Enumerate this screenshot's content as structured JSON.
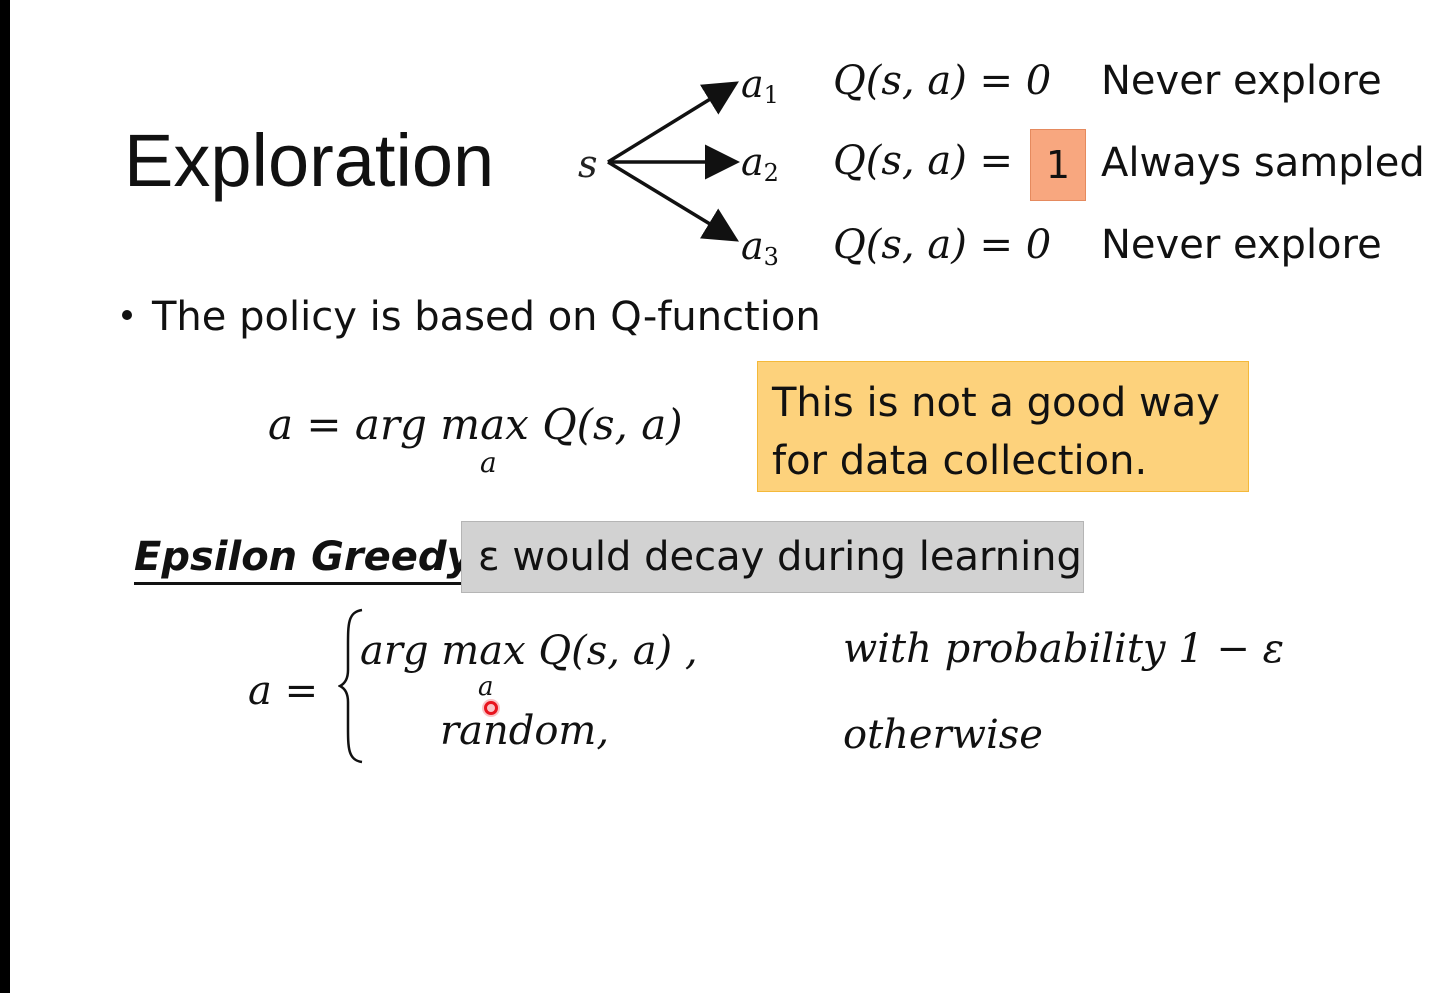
{
  "title": "Exploration",
  "tree": {
    "state": "s",
    "actions": [
      {
        "base": "a",
        "sub": "1",
        "q_expr": "Q(s, a) = 0",
        "label": "Never explore"
      },
      {
        "base": "a",
        "sub": "2",
        "q_expr": "Q(s, a) =",
        "q_value": "1",
        "label": "Always sampled"
      },
      {
        "base": "a",
        "sub": "3",
        "q_expr": "Q(s, a) = 0",
        "label": "Never explore"
      }
    ]
  },
  "bullet": "The policy is based on Q-function",
  "policy_formula": {
    "main": "a = arg max Q(s, a)",
    "subscript": "a"
  },
  "note": "This is not a good way for data collection.",
  "epsilon_greedy": {
    "title": "Epsilon Greedy",
    "decay_note": "ε would decay during learning",
    "lhs": "a =",
    "case1": {
      "expr": "arg max Q(s, a) ,",
      "subscript": "a",
      "condition": "with probability 1 − ε"
    },
    "case2": {
      "expr": "random,",
      "condition": "otherwise"
    }
  },
  "colors": {
    "highlight_value": "#f8a77f",
    "note_box": "#fdd27c",
    "decay_box": "#d2d2d2",
    "cursor": "#e8141e"
  }
}
